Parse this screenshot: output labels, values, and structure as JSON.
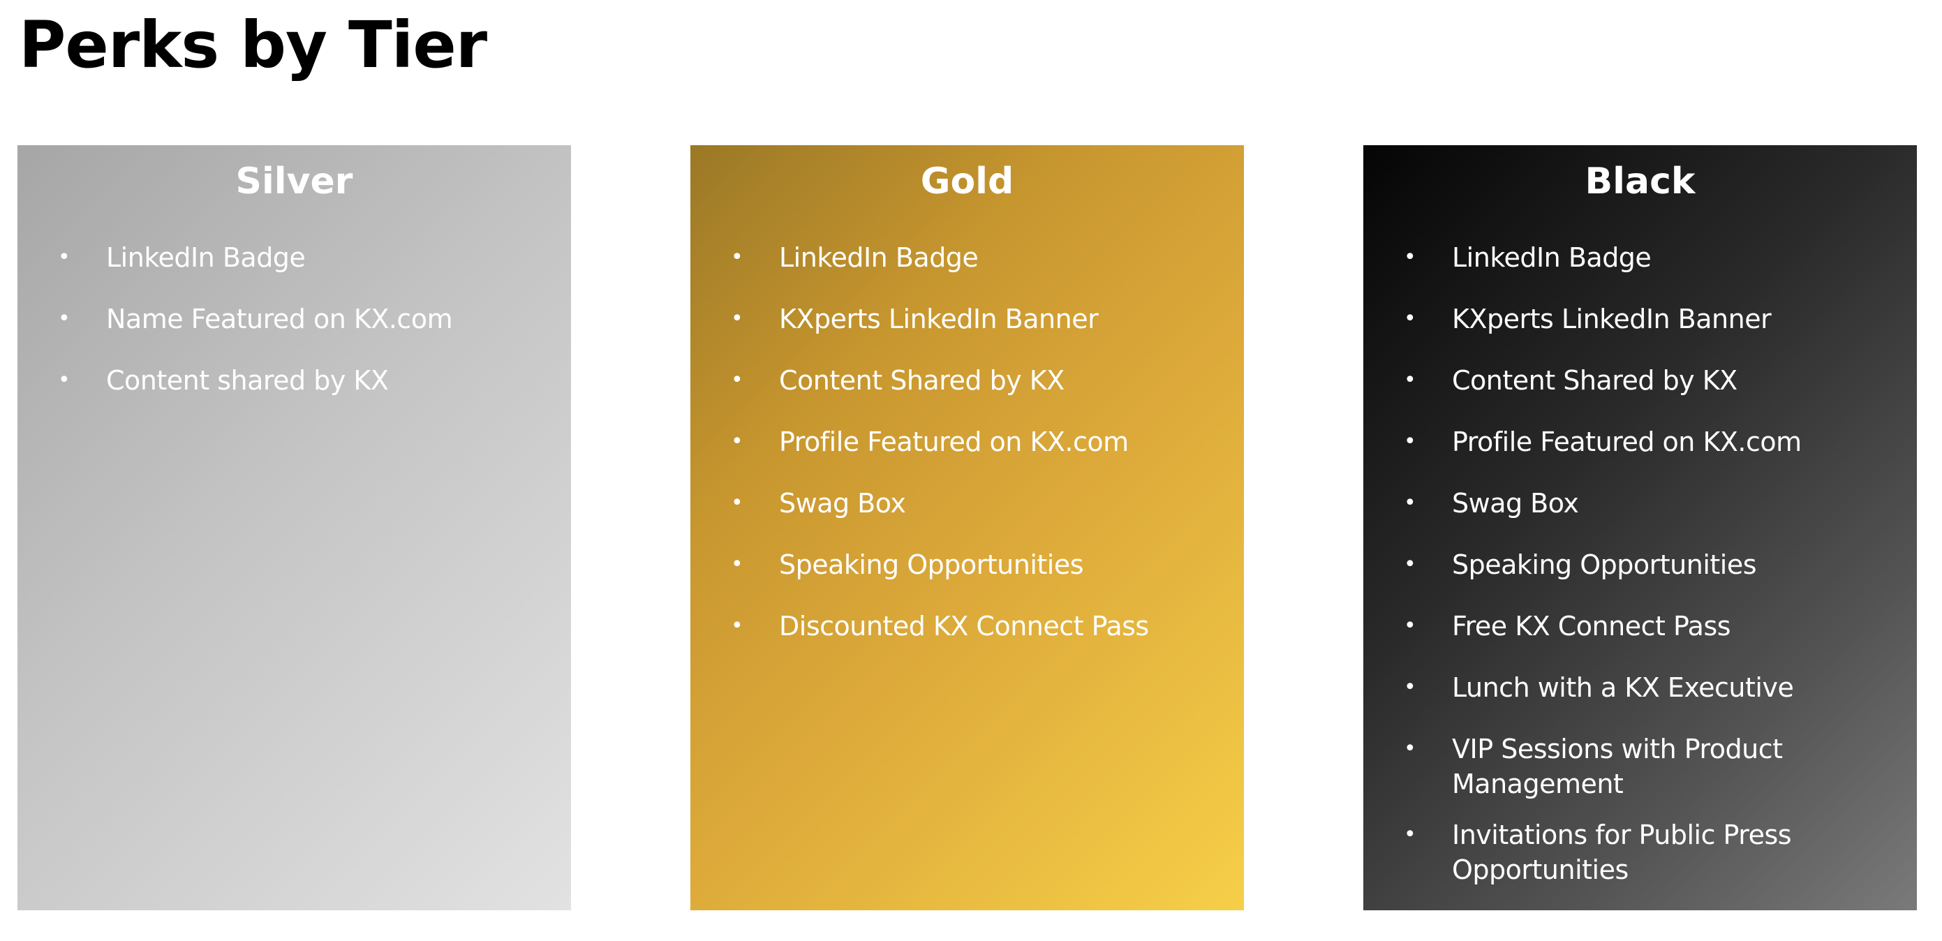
{
  "title": "Perks by Tier",
  "tiers": [
    {
      "name": "Silver",
      "perks": [
        "LinkedIn Badge",
        "Name Featured on KX.com",
        "Content shared by KX"
      ]
    },
    {
      "name": "Gold",
      "perks": [
        "LinkedIn Badge",
        "KXperts LinkedIn Banner",
        "Content Shared by KX",
        "Profile Featured on KX.com",
        "Swag Box",
        "Speaking Opportunities",
        "Discounted KX Connect Pass"
      ]
    },
    {
      "name": "Black",
      "perks": [
        "LinkedIn Badge",
        "KXperts LinkedIn Banner",
        "Content Shared by KX",
        "Profile Featured on KX.com",
        "Swag Box",
        "Speaking Opportunities",
        "Free KX Connect Pass",
        "Lunch with a KX Executive",
        "VIP Sessions with Product Management",
        "Invitations for Public Press Opportunities"
      ]
    }
  ],
  "colors": {
    "silver": "#c4c4c4",
    "gold": "#dca93a",
    "black": "#2a2a2a",
    "text": "#ffffff"
  }
}
